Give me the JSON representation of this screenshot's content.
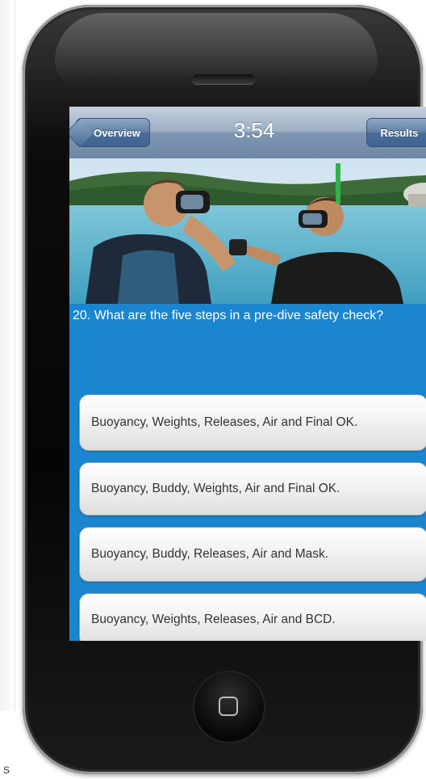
{
  "app": {
    "nav": {
      "back_label": "Overview",
      "timer": "3:54",
      "right_label": "Results"
    },
    "question": {
      "text": "20. What are the five steps in a pre-dive safety check?"
    },
    "answers": [
      {
        "label": "Buoyancy, Weights, Releases, Air and Final OK."
      },
      {
        "label": "Buoyancy, Buddy, Weights, Air and Final OK."
      },
      {
        "label": "Buoyancy, Buddy, Releases, Air and Mask."
      },
      {
        "label": "Buoyancy, Weights, Releases, Air and BCD."
      }
    ]
  },
  "page": {
    "corner_mark": "S"
  },
  "colors": {
    "screen_background": "#1a86d0",
    "nav_button": "#4a6d98",
    "phone_body": "#050505"
  },
  "icons": {
    "home_button": "home-square-icon"
  }
}
